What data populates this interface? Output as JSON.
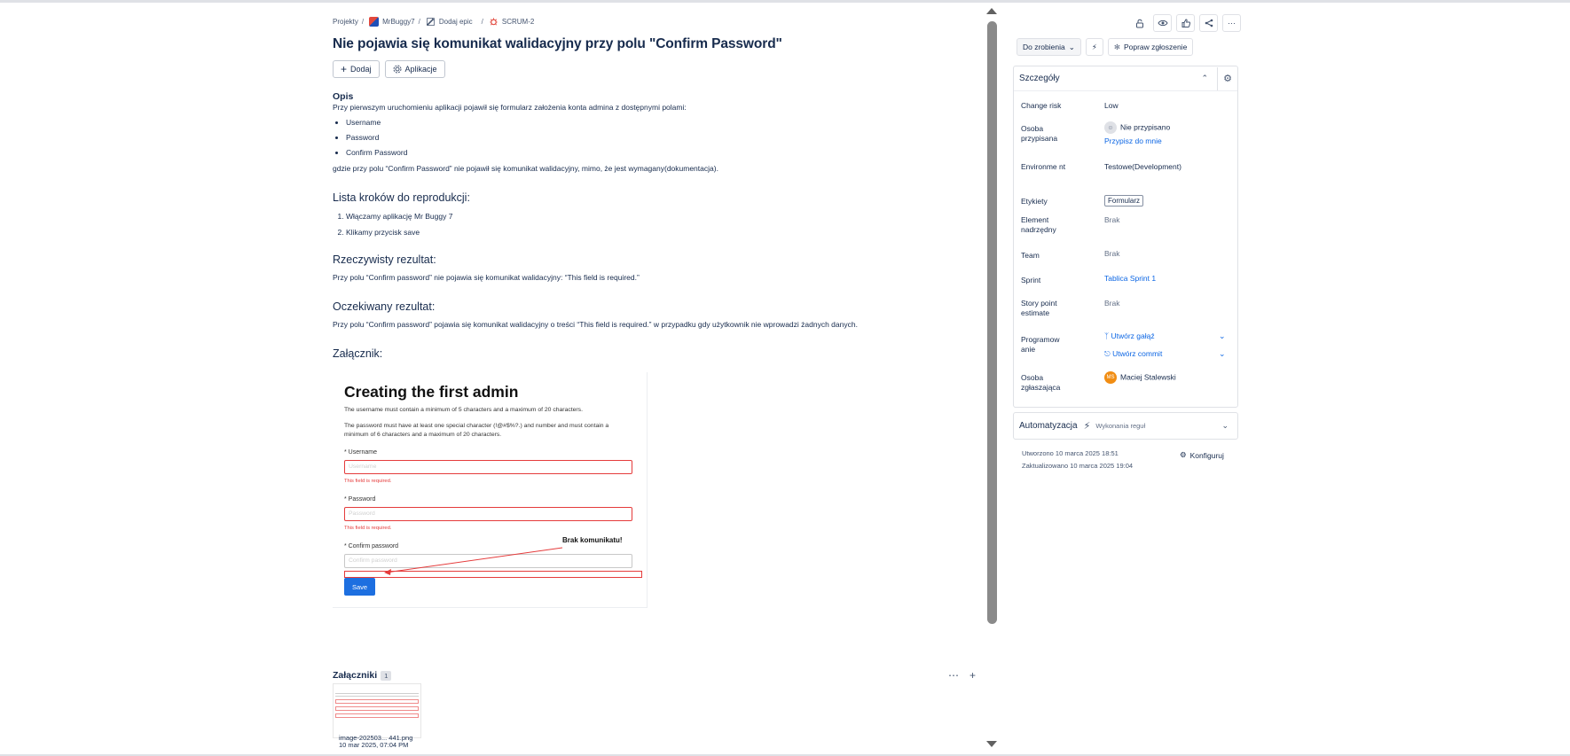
{
  "breadcrumb": {
    "projects": "Projekty",
    "project": "MrBuggy7",
    "epic": "Dodaj epic",
    "issue": "SCRUM-2"
  },
  "issue": {
    "title": "Nie pojawia się komunikat walidacyjny przy polu \"Confirm Password\"",
    "add_label": "Dodaj",
    "apps_label": "Aplikacje"
  },
  "description": {
    "heading": "Opis",
    "intro": "Przy pierwszym uruchomieniu aplikacji pojawił się formularz założenia konta admina z dostępnymi polami:",
    "fields": [
      "Username",
      "Password",
      "Confirm Password"
    ],
    "outro": "gdzie przy polu “Confirm Password” nie pojawił się komunikat walidacyjny, mimo, że jest wymagany(dokumentacja).",
    "steps_heading": "Lista kroków do reprodukcji:",
    "steps": [
      "Włączamy aplikację Mr Buggy 7",
      "Klikamy przycisk save"
    ],
    "actual_heading": "Rzeczywisty rezultat:",
    "actual_text": "Przy polu “Confirm password” nie pojawia się komunikat walidacyjny: “This field is required.”",
    "expected_heading": "Oczekiwany rezultat:",
    "expected_text": "Przy polu “Confirm password” pojawia się komunikat walidacyjny o treści “This field is required.” w przypadku gdy użytkownik nie wprowadzi żadnych danych.",
    "attachment_heading": "Załącznik:"
  },
  "screenshot": {
    "title": "Creating the first admin",
    "rule1": "The username must contain a minimum of 5 characters and a maximum of 20 characters.",
    "rule2": "The password must have at least one special character (!@#$%?.) and number and must contain a minimum of 6 characters and a maximum of 20 characters.",
    "username_label": "* Username",
    "username_placeholder": "Username",
    "username_error": "This field is required.",
    "password_label": "* Password",
    "password_placeholder": "Password",
    "password_error": "This field is required.",
    "confirm_label": "* Confirm password",
    "confirm_placeholder": "Confirm password",
    "save_label": "Save",
    "annotation": "Brak komunikatu!"
  },
  "attachments": {
    "title": "Załączniki",
    "count": "1",
    "file_name": "image-202503... 441.png",
    "file_date": "10 mar 2025, 07:04 PM"
  },
  "sidebar": {
    "status": "Do zrobienia",
    "improve": "Popraw zgłoszenie",
    "details_title": "Szczegóły",
    "fields": {
      "change_risk_label": "Change risk",
      "change_risk_value": "Low",
      "assignee_label": "Osoba przypisana",
      "assignee_value": "Nie przypisano",
      "assign_me": "Przypisz do mnie",
      "environment_label": "Environme nt",
      "environment_value": "Testowe(Development)",
      "labels_label": "Etykiety",
      "labels_value": "Formularz",
      "parent_label": "Element nadrzędny",
      "parent_value": "Brak",
      "team_label": "Team",
      "team_value": "Brak",
      "sprint_label": "Sprint",
      "sprint_value": "Tablica Sprint 1",
      "story_label": "Story point estimate",
      "story_value": "Brak",
      "dev_label": "Programow anie",
      "dev_branch": "Utwórz gałąź",
      "dev_commit": "Utwórz commit",
      "reporter_label": "Osoba zgłaszająca",
      "reporter_initials": "MS",
      "reporter_value": "Maciej Stalewski"
    },
    "automation_title": "Automatyzacja",
    "automation_rules": "Wykonania reguł",
    "created": "Utworzono 10 marca 2025 18:51",
    "updated": "Zaktualizowano 10 marca 2025 19:04",
    "configure": "Konfiguruj"
  }
}
